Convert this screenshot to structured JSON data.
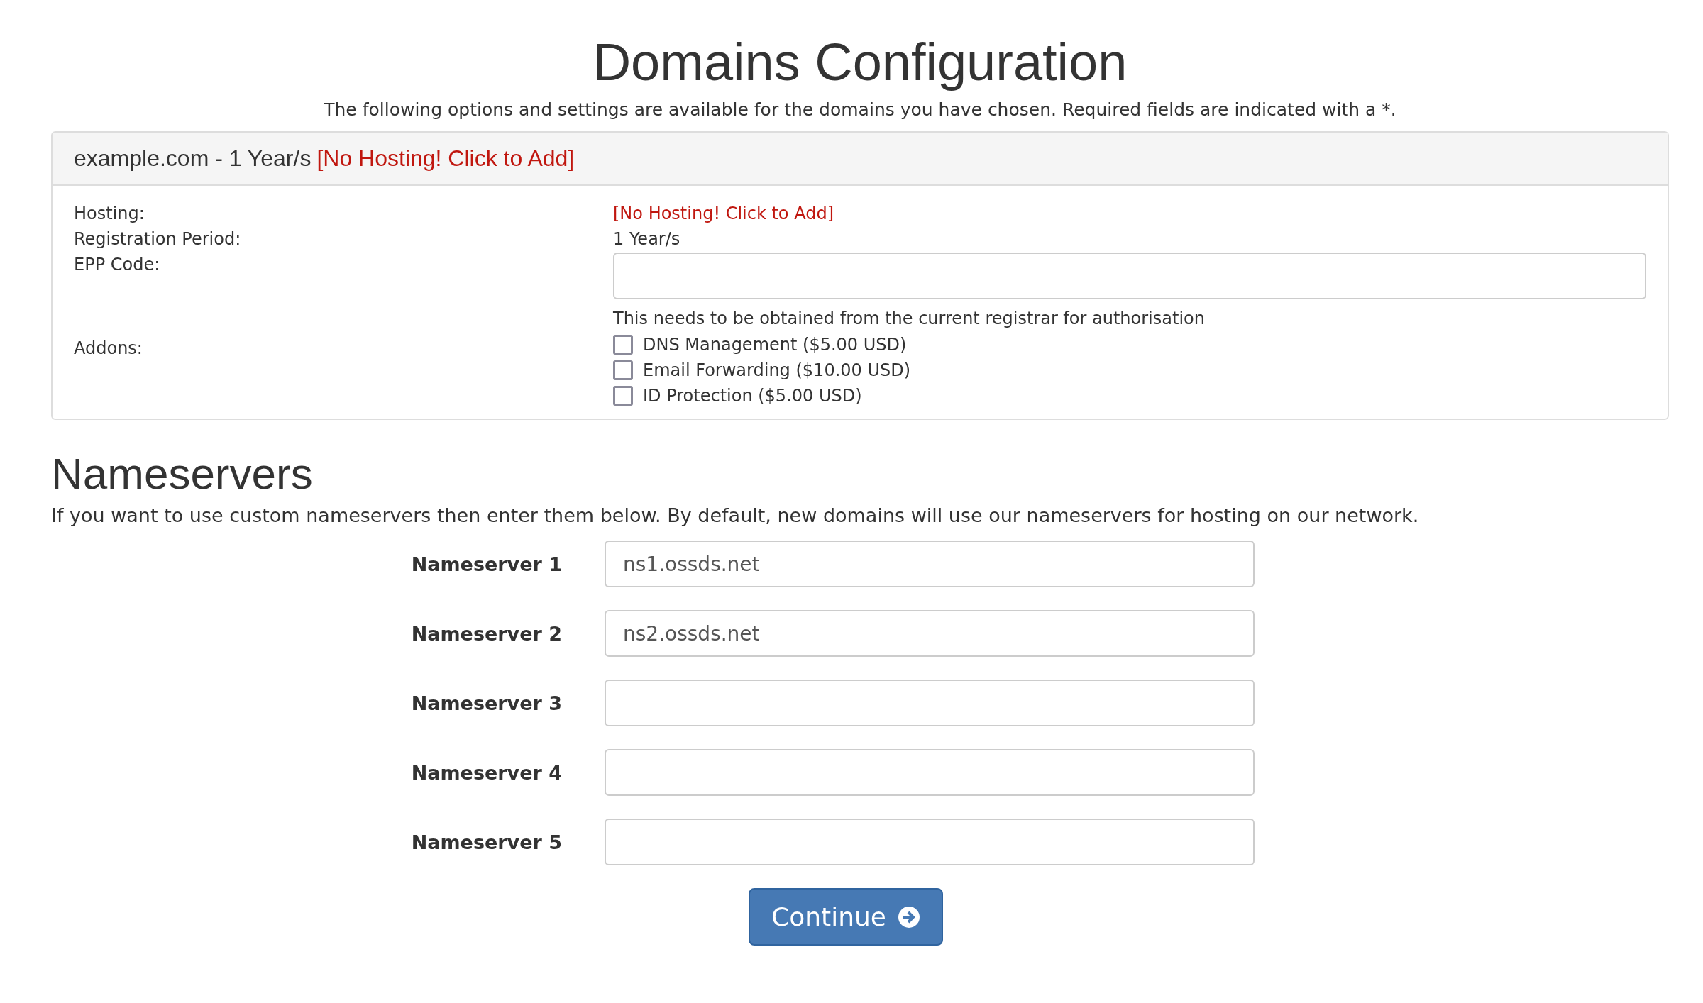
{
  "page": {
    "title": "Domains Configuration",
    "intro": "The following options and settings are available for the domains you have chosen. Required fields are indicated with a *."
  },
  "domain_panel": {
    "domain": "example.com - 1 Year/s",
    "hosting_link": "[No Hosting! Click to Add]",
    "fields": [
      {
        "kind": "link",
        "label": "Hosting:",
        "value": "[No Hosting! Click to Add]"
      },
      {
        "kind": "text",
        "label": "Registration Period:",
        "value": "1 Year/s"
      },
      {
        "kind": "input",
        "label": "EPP Code:",
        "help": "This needs to be obtained from the current registrar for authorisation"
      },
      {
        "kind": "addons",
        "label": "Addons:",
        "addons": [
          {
            "label": "DNS Management ($5.00 USD)",
            "checked": false
          },
          {
            "label": "Email Forwarding ($10.00 USD)",
            "checked": false
          },
          {
            "label": "ID Protection ($5.00 USD)",
            "checked": false
          }
        ]
      }
    ]
  },
  "nameservers": {
    "heading": "Nameservers",
    "description": "If you want to use custom nameservers then enter them below. By default, new domains will use our nameservers for hosting on our network.",
    "fields": [
      {
        "label": "Nameserver 1",
        "value": "ns1.ossds.net"
      },
      {
        "label": "Nameserver 2",
        "value": "ns2.ossds.net"
      },
      {
        "label": "Nameserver 3"
      },
      {
        "label": "Nameserver 4"
      },
      {
        "label": "Nameserver 5"
      }
    ]
  },
  "continue_button": "Continue"
}
